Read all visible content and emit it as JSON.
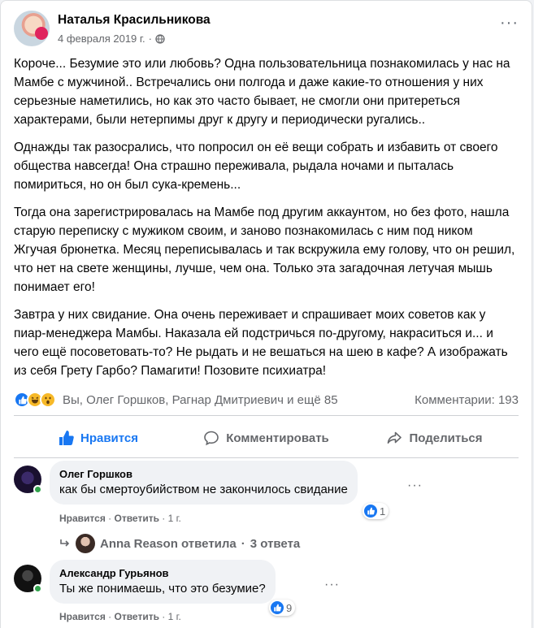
{
  "post": {
    "author": "Наталья Красильникова",
    "date": "4 февраля 2019 г.",
    "separator": "·",
    "paragraphs": [
      "Короче... Безумие это или любовь? Одна пользовательница познакомилась у нас на Мамбе с мужчиной.. Встречались они полгода и даже какие-то отношения у них серьезные наметились, но как это часто бывает, не смогли они притереться характерами, были нетерпимы друг к другу и периодически ругались..",
      "Однажды так разосрались, что попросил он её вещи собрать и избавить от своего общества навсегда! Она страшно переживала, рыдала ночами и пыталась помириться, но он был сука-кремень...",
      "Тогда она зарегистрировалась на Мамбе под другим аккаунтом, но без фото, нашла старую переписку с мужиком своим, и заново познакомилась с ним под ником Жгучая брюнетка. Месяц переписывалась и так вскружила ему голову, что он решил, что нет на свете женщины, лучше, чем она. Только эта загадочная летучая мышь понимает его!",
      "Завтра у них свидание. Она очень переживает и спрашивает моих советов как у пиар-менеджера Мамбы. Наказала ей подстричься по-другому, накраситься и... и чего ещё посоветовать-то? Не рыдать и не вешаться на шею в кафе? А изображать из себя Грету Гарбо? Памагити! Позовите психиатра!"
    ],
    "reactions_text": "Вы, Олег Горшков, Рагнар Дмитриевич и ещё 85",
    "comments_count_text": "Комментарии: 193"
  },
  "actions": {
    "like": "Нравится",
    "comment": "Комментировать",
    "share": "Поделиться"
  },
  "comments": [
    {
      "name": "Олег Горшков",
      "text": "как бы смертоубийством не закончилось свидание",
      "like_label": "Нравится",
      "reply_label": "Ответить",
      "age": "1 г.",
      "likes": "1"
    },
    {
      "name": "Александр Гурьянов",
      "text": "Ты же понимаешь, что это безумие?",
      "like_label": "Нравится",
      "reply_label": "Ответить",
      "age": "1 г.",
      "likes": "9"
    }
  ],
  "replies": {
    "text": "Anna Reason ответила",
    "separator": "·",
    "count": "3 ответа"
  },
  "colors": {
    "accent": "#1877f2",
    "muted": "#65676b",
    "bubble": "#f0f2f5",
    "online": "#31a24c"
  }
}
